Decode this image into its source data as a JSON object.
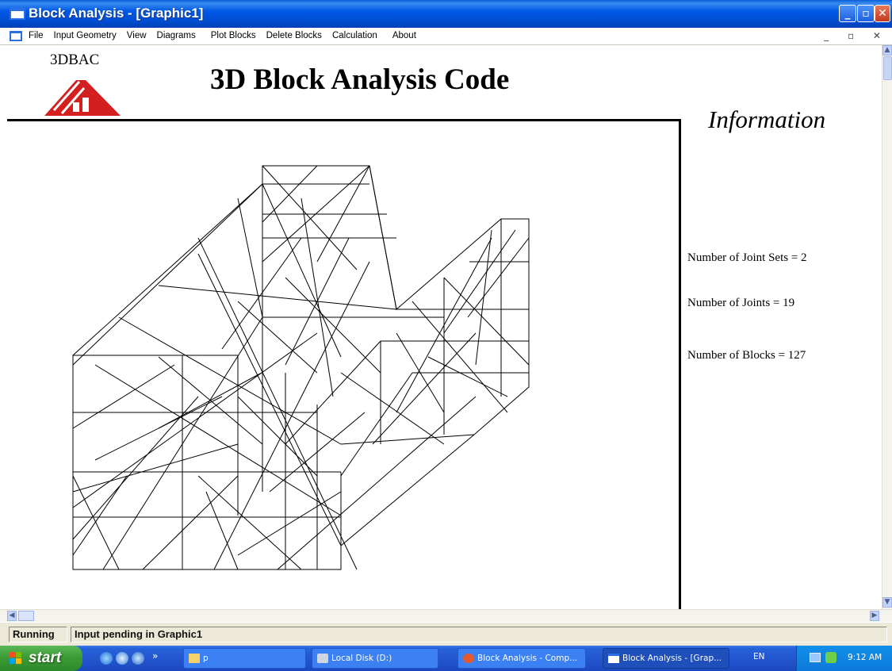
{
  "window": {
    "title": "Block Analysis - [Graphic1]"
  },
  "menu": {
    "items": [
      "File",
      "Input Geometry",
      "View",
      "Diagrams",
      "Plot Blocks",
      "Delete Blocks",
      "Calculation",
      "About"
    ]
  },
  "header": {
    "logo_text": "3DBAC",
    "title": "3D Block Analysis Code"
  },
  "info": {
    "title": "Information",
    "joint_sets": "Number of Joint Sets = 2",
    "joints": "Number of Joints = 19",
    "blocks": "Number of Blocks = 127"
  },
  "status": {
    "pane1": "Running",
    "pane2": "Input pending in Graphic1"
  },
  "taskbar": {
    "start": "start",
    "quick_launch_more": "»",
    "folder": "p",
    "tasks": [
      "Local Disk (D:)",
      "Block Analysis - Comp...",
      "Block Analysis - [Grap..."
    ],
    "lang": "EN",
    "clock": "9:12 AM"
  },
  "colors": {
    "xp_blue": "#0058e6",
    "start_green": "#3c9b35",
    "logo_red": "#d31f1f"
  }
}
